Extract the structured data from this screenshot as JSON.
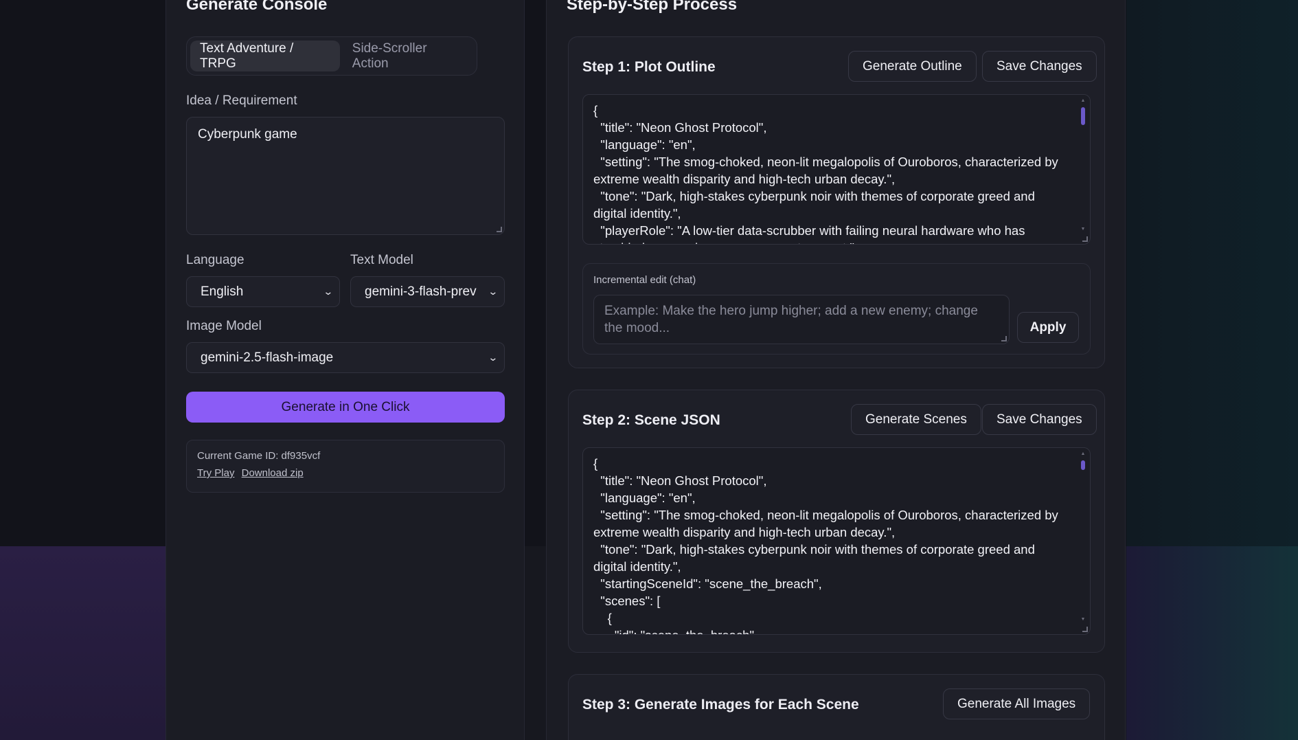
{
  "console": {
    "title": "Generate Console",
    "mode_tabs": [
      "Text Adventure / TRPG",
      "Side-Scroller Action"
    ],
    "active_tab": "Text Adventure / TRPG",
    "idea_label": "Idea / Requirement",
    "idea_value": "Cyberpunk game",
    "language_label": "Language",
    "language_value": "English",
    "text_model_label": "Text Model",
    "text_model_value": "gemini-3-flash-prev",
    "image_model_label": "Image Model",
    "image_model_value": "gemini-2.5-flash-image",
    "generate_button": "Generate in One Click",
    "game_id_label": "Current Game ID:",
    "game_id_value": "df935vcf",
    "try_play": "Try Play",
    "download_zip": "Download zip"
  },
  "process": {
    "title": "Step-by-Step Process",
    "step1": {
      "title": "Step 1: Plot Outline",
      "generate_button": "Generate Outline",
      "save_button": "Save Changes",
      "content": "{\n  \"title\": \"Neon Ghost Protocol\",\n  \"language\": \"en\",\n  \"setting\": \"The smog-choked, neon-lit megalopolis of Ouroboros, characterized by extreme wealth disparity and high-tech urban decay.\",\n  \"tone\": \"Dark, high-stakes cyberpunk noir with themes of corporate greed and digital identity.\",\n  \"playerRole\": \"A low-tier data-scrubber with failing neural hardware who has stumbled upon a dangerous corporate secret.\",",
      "chat_label": "Incremental edit (chat)",
      "chat_placeholder": "Example: Make the hero jump higher; add a new enemy; change the mood...",
      "apply_button": "Apply"
    },
    "step2": {
      "title": "Step 2: Scene JSON",
      "generate_button": "Generate Scenes",
      "save_button": "Save Changes",
      "content": "{\n  \"title\": \"Neon Ghost Protocol\",\n  \"language\": \"en\",\n  \"setting\": \"The smog-choked, neon-lit megalopolis of Ouroboros, characterized by extreme wealth disparity and high-tech urban decay.\",\n  \"tone\": \"Dark, high-stakes cyberpunk noir with themes of corporate greed and digital identity.\",\n  \"startingSceneId\": \"scene_the_breach\",\n  \"scenes\": [\n    {\n      \"id\": \"scene_the_breach\","
    },
    "step3": {
      "title": "Step 3: Generate Images for Each Scene",
      "generate_button": "Generate All Images"
    }
  }
}
